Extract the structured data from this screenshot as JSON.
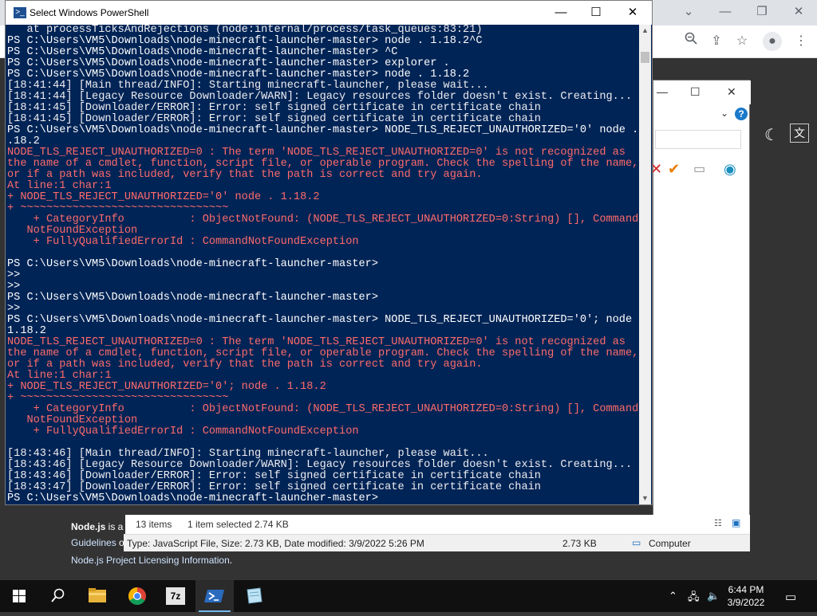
{
  "powershell": {
    "title": "Select Windows PowerShell",
    "lines": [
      {
        "t": "   at processTicksAndRejections (node:internal/process/task_queues:83:21)",
        "k": "out"
      },
      {
        "t": "PS C:\\Users\\VM5\\Downloads\\node-minecraft-launcher-master> node . 1.18.2^C",
        "k": "cmd"
      },
      {
        "t": "PS C:\\Users\\VM5\\Downloads\\node-minecraft-launcher-master> ^C",
        "k": "cmd"
      },
      {
        "t": "PS C:\\Users\\VM5\\Downloads\\node-minecraft-launcher-master> explorer .",
        "k": "cmd"
      },
      {
        "t": "PS C:\\Users\\VM5\\Downloads\\node-minecraft-launcher-master> node . 1.18.2",
        "k": "cmd"
      },
      {
        "t": "[18:41:44] [Main thread/INFO]: Starting minecraft-launcher, please wait...",
        "k": "out"
      },
      {
        "t": "[18:41:44] [Legacy Resource Downloader/WARN]: Legacy resources folder doesn't exist. Creating...",
        "k": "out"
      },
      {
        "t": "[18:41:45] [Downloader/ERROR]: Error: self signed certificate in certificate chain",
        "k": "out"
      },
      {
        "t": "[18:41:45] [Downloader/ERROR]: Error: self signed certificate in certificate chain",
        "k": "out"
      },
      {
        "t": "PS C:\\Users\\VM5\\Downloads\\node-minecraft-launcher-master> NODE_TLS_REJECT_UNAUTHORIZED='0' node . 1",
        "k": "cmd"
      },
      {
        "t": ".18.2",
        "k": "cmd"
      },
      {
        "t": "NODE_TLS_REJECT_UNAUTHORIZED=0 : The term 'NODE_TLS_REJECT_UNAUTHORIZED=0' is not recognized as",
        "k": "err"
      },
      {
        "t": "the name of a cmdlet, function, script file, or operable program. Check the spelling of the name,",
        "k": "err"
      },
      {
        "t": "or if a path was included, verify that the path is correct and try again.",
        "k": "err"
      },
      {
        "t": "At line:1 char:1",
        "k": "err"
      },
      {
        "t": "+ NODE_TLS_REJECT_UNAUTHORIZED='0' node . 1.18.2",
        "k": "err"
      },
      {
        "t": "+ ~~~~~~~~~~~~~~~~~~~~~~~~~~~~~~~~",
        "k": "err"
      },
      {
        "t": "    + CategoryInfo          : ObjectNotFound: (NODE_TLS_REJECT_UNAUTHORIZED=0:String) [], Command",
        "k": "err"
      },
      {
        "t": "   NotFoundException",
        "k": "err"
      },
      {
        "t": "    + FullyQualifiedErrorId : CommandNotFoundException",
        "k": "err"
      },
      {
        "t": "",
        "k": "out"
      },
      {
        "t": "PS C:\\Users\\VM5\\Downloads\\node-minecraft-launcher-master>",
        "k": "cmd"
      },
      {
        "t": ">>",
        "k": "cmd"
      },
      {
        "t": ">>",
        "k": "cmd"
      },
      {
        "t": "PS C:\\Users\\VM5\\Downloads\\node-minecraft-launcher-master>",
        "k": "cmd"
      },
      {
        "t": ">>",
        "k": "cmd"
      },
      {
        "t": "PS C:\\Users\\VM5\\Downloads\\node-minecraft-launcher-master> NODE_TLS_REJECT_UNAUTHORIZED='0'; node .",
        "k": "cmd"
      },
      {
        "t": "1.18.2",
        "k": "cmd"
      },
      {
        "t": "NODE_TLS_REJECT_UNAUTHORIZED=0 : The term 'NODE_TLS_REJECT_UNAUTHORIZED=0' is not recognized as",
        "k": "err"
      },
      {
        "t": "the name of a cmdlet, function, script file, or operable program. Check the spelling of the name,",
        "k": "err"
      },
      {
        "t": "or if a path was included, verify that the path is correct and try again.",
        "k": "err"
      },
      {
        "t": "At line:1 char:1",
        "k": "err"
      },
      {
        "t": "+ NODE_TLS_REJECT_UNAUTHORIZED='0'; node . 1.18.2",
        "k": "err"
      },
      {
        "t": "+ ~~~~~~~~~~~~~~~~~~~~~~~~~~~~~~~~",
        "k": "err"
      },
      {
        "t": "    + CategoryInfo          : ObjectNotFound: (NODE_TLS_REJECT_UNAUTHORIZED=0:String) [], Command",
        "k": "err"
      },
      {
        "t": "   NotFoundException",
        "k": "err"
      },
      {
        "t": "    + FullyQualifiedErrorId : CommandNotFoundException",
        "k": "err"
      },
      {
        "t": "",
        "k": "out"
      },
      {
        "t": "[18:43:46] [Main thread/INFO]: Starting minecraft-launcher, please wait...",
        "k": "out"
      },
      {
        "t": "[18:43:46] [Legacy Resource Downloader/WARN]: Legacy resources folder doesn't exist. Creating...",
        "k": "out"
      },
      {
        "t": "[18:43:46] [Downloader/ERROR]: Error: self signed certificate in certificate chain",
        "k": "out"
      },
      {
        "t": "[18:43:47] [Downloader/ERROR]: Error: self signed certificate in certificate chain",
        "k": "out"
      },
      {
        "t": "PS C:\\Users\\VM5\\Downloads\\node-minecraft-launcher-master>",
        "k": "cmd"
      }
    ]
  },
  "explorer": {
    "status_items": "13 items",
    "status_selected": "1 item selected  2.74 KB",
    "details_type": "Type: JavaScript File, Size: 2.73 KB, Date modified: 3/9/2022 5:26 PM",
    "details_size": "2.73 KB",
    "details_location": "Computer",
    "help_label": "?"
  },
  "page": {
    "nodejs_bold": "Node.js",
    "nodejs_rest": " is a t",
    "guidelines_link": "Guidelines",
    "guidelines_rest": " o",
    "licensing_link": "Node.js Project Licensing Information",
    "licensing_rest": "."
  },
  "taskbar": {
    "time": "6:44 PM",
    "date": "3/9/2022",
    "apps": [
      "start",
      "search",
      "file-explorer",
      "chrome",
      "7zip",
      "powershell",
      "notepad"
    ]
  }
}
